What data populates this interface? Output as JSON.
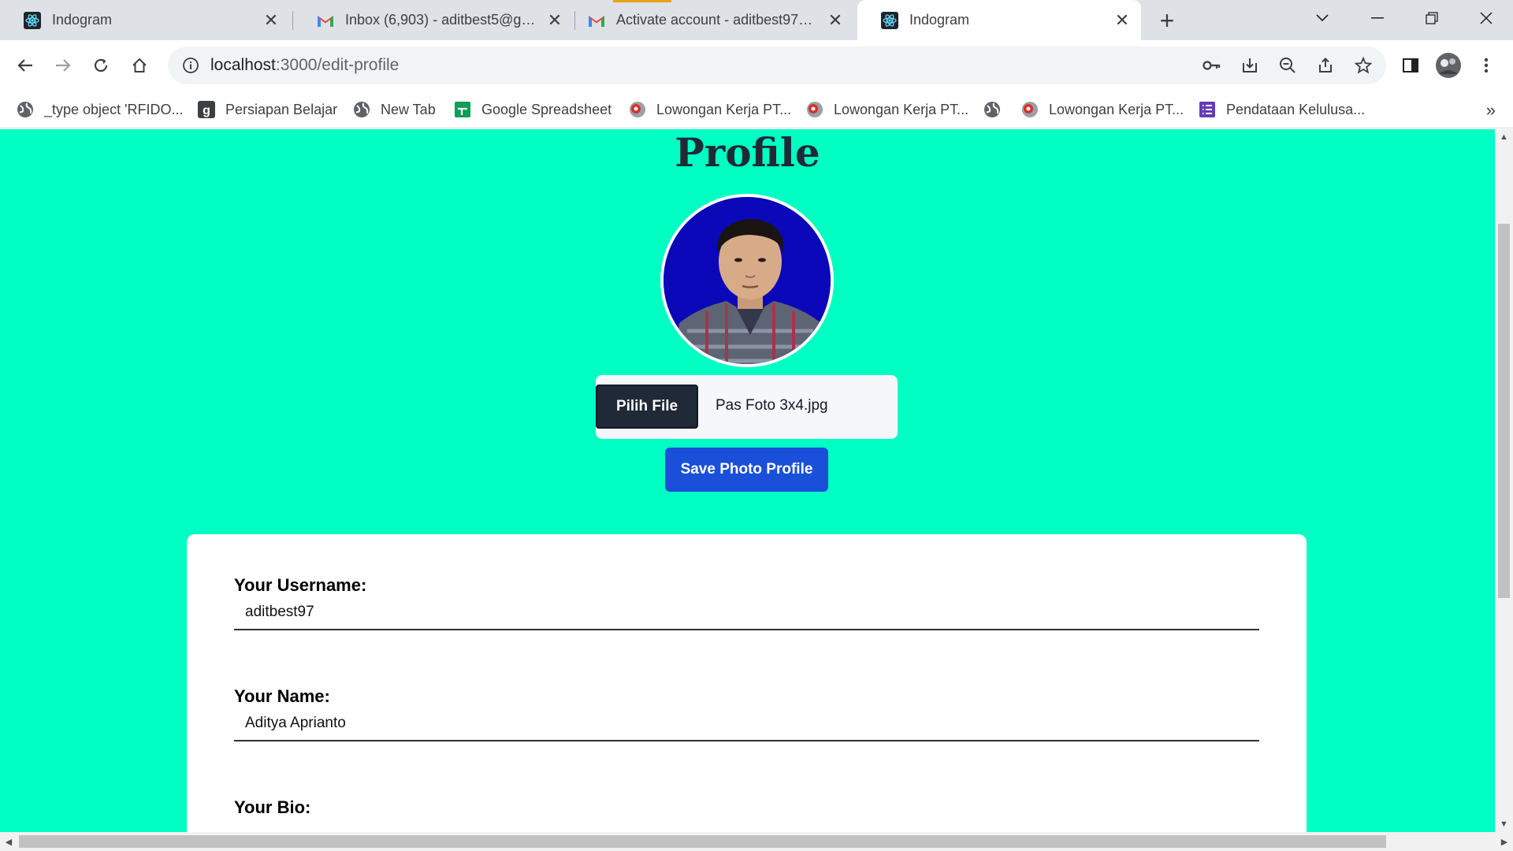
{
  "browser": {
    "tabs": [
      {
        "title": "Indogram",
        "icon": "react-icon",
        "active": false
      },
      {
        "title": "Inbox (6,903) - aditbest5@gmail.com",
        "icon": "gmail-icon",
        "active": false
      },
      {
        "title": "Activate account - aditbest97@gmail.com",
        "icon": "gmail-icon",
        "active": false
      },
      {
        "title": "Indogram",
        "icon": "react-icon",
        "active": true
      }
    ],
    "new_tab": "+",
    "address": {
      "host": "localhost",
      "path": ":3000/edit-profile"
    },
    "bookmarks": [
      {
        "label": "_type object 'RFIDO...",
        "icon": "globe-icon"
      },
      {
        "label": "Persiapan Belajar",
        "icon": "g-logo-icon"
      },
      {
        "label": "New Tab",
        "icon": "globe-icon"
      },
      {
        "label": "Google Spreadsheet",
        "icon": "sheets-icon"
      },
      {
        "label": "Lowongan Kerja PT...",
        "icon": "jobs-icon"
      },
      {
        "label": "Lowongan Kerja PT...",
        "icon": "jobs-icon"
      },
      {
        "label": "",
        "icon": "globe-icon"
      },
      {
        "label": "Lowongan Kerja PT...",
        "icon": "jobs-icon"
      },
      {
        "label": "Pendataan Kelulusa...",
        "icon": "forms-icon"
      }
    ],
    "bookmarks_more": "»"
  },
  "page": {
    "title": "Profile",
    "file_button": "Pilih File",
    "file_name": "Pas Foto 3x4.jpg",
    "save_button": "Save Photo Profile",
    "fields": [
      {
        "label": "Your Username:",
        "value": "aditbest97"
      },
      {
        "label": "Your Name:",
        "value": "Aditya Aprianto"
      },
      {
        "label": "Your Bio:",
        "value": ""
      }
    ]
  },
  "colors": {
    "page_background": "#00ffc3",
    "save_button": "#1a4fd9",
    "file_button": "#1f2937"
  }
}
